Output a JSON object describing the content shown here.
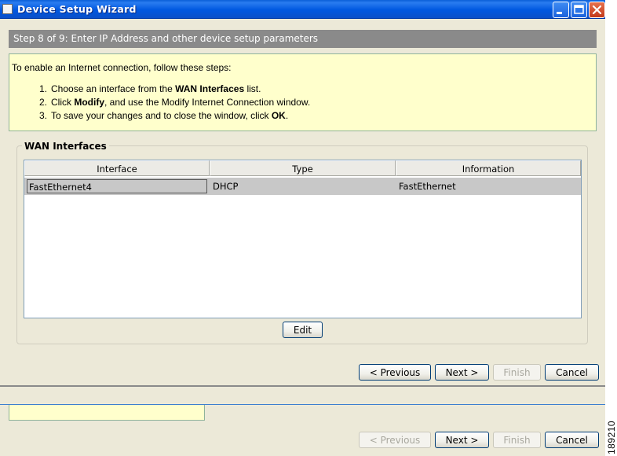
{
  "window": {
    "title": "Device Setup Wizard"
  },
  "step": {
    "text": "Step 8 of 9: Enter IP Address and other device setup parameters"
  },
  "info": {
    "intro": "To enable an Internet connection, follow these steps:",
    "steps": [
      {
        "num": "1.",
        "pre": "Choose an interface from the ",
        "bold": "WAN Interfaces",
        "post": " list."
      },
      {
        "num": "2.",
        "pre": "Click ",
        "bold": "Modify",
        "post": ", and use the Modify Internet Connection window."
      },
      {
        "num": "3.",
        "pre": "To save your changes and to close the window, click ",
        "bold": "OK",
        "post": "."
      }
    ]
  },
  "wan": {
    "label": "WAN Interfaces",
    "columns": [
      "Interface",
      "Type",
      "Information"
    ],
    "rows": [
      {
        "interface": "FastEthernet4",
        "type": "DHCP",
        "information": "FastEthernet"
      }
    ],
    "edit_label": "Edit"
  },
  "nav": {
    "previous_label": "< Previous",
    "next_label": "Next >",
    "finish_label": "Finish",
    "cancel_label": "Cancel"
  },
  "figure_id": "189210",
  "colors": {
    "titlebar": "#0058e0",
    "step_bar": "#8a8a8a",
    "info_background": "#ffffcc",
    "selected_row": "#c8c8c8"
  },
  "icons": [
    "app-icon",
    "minimize-icon",
    "maximize-icon",
    "close-icon"
  ]
}
